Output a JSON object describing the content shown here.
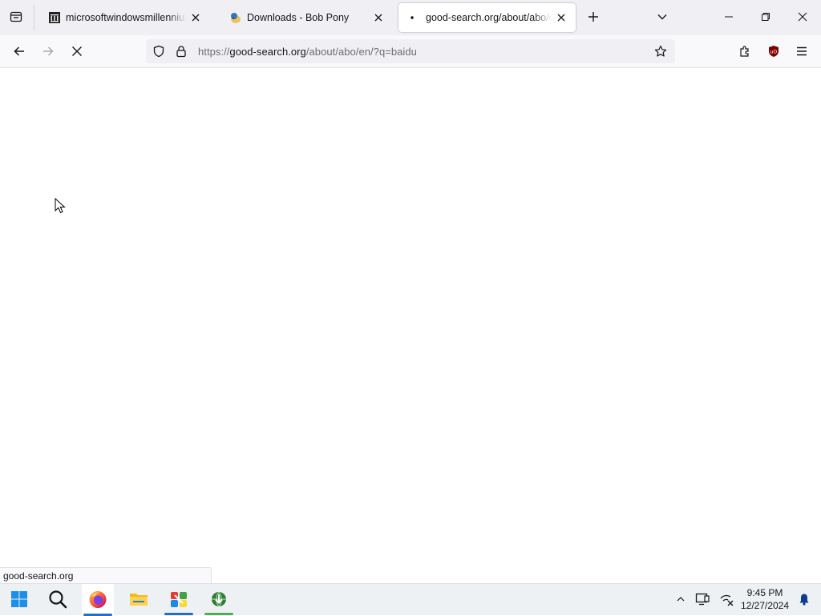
{
  "browser": {
    "tabs": [
      {
        "title": "microsoftwindowsmillenniumb",
        "favicon": "archive-building-icon",
        "active": false
      },
      {
        "title": "Downloads - Bob Pony",
        "favicon": "pony-icon",
        "active": false
      },
      {
        "title": "good-search.org/about/abo/en",
        "favicon": "loading-dot-icon",
        "active": true
      }
    ],
    "url": {
      "scheme": "https://",
      "domain": "good-search.org",
      "path": "/about/abo/en/?q=baidu"
    },
    "status_text": "good-search.org",
    "loading": true
  },
  "taskbar": {
    "apps": [
      "windows-start",
      "search",
      "firefox",
      "file-explorer",
      "app-4",
      "app-5"
    ],
    "clock": {
      "time": "9:45 PM",
      "date": "12/27/2024"
    }
  },
  "colors": {
    "tabstrip_bg": "#f0f0f4",
    "toolbar_bg": "#f9f9fb",
    "urlbar_bg": "#f0f0f4",
    "taskbar_bg": "#eef1f4",
    "accent_blue": "#1f6fd1",
    "ublock_red": "#800000"
  }
}
